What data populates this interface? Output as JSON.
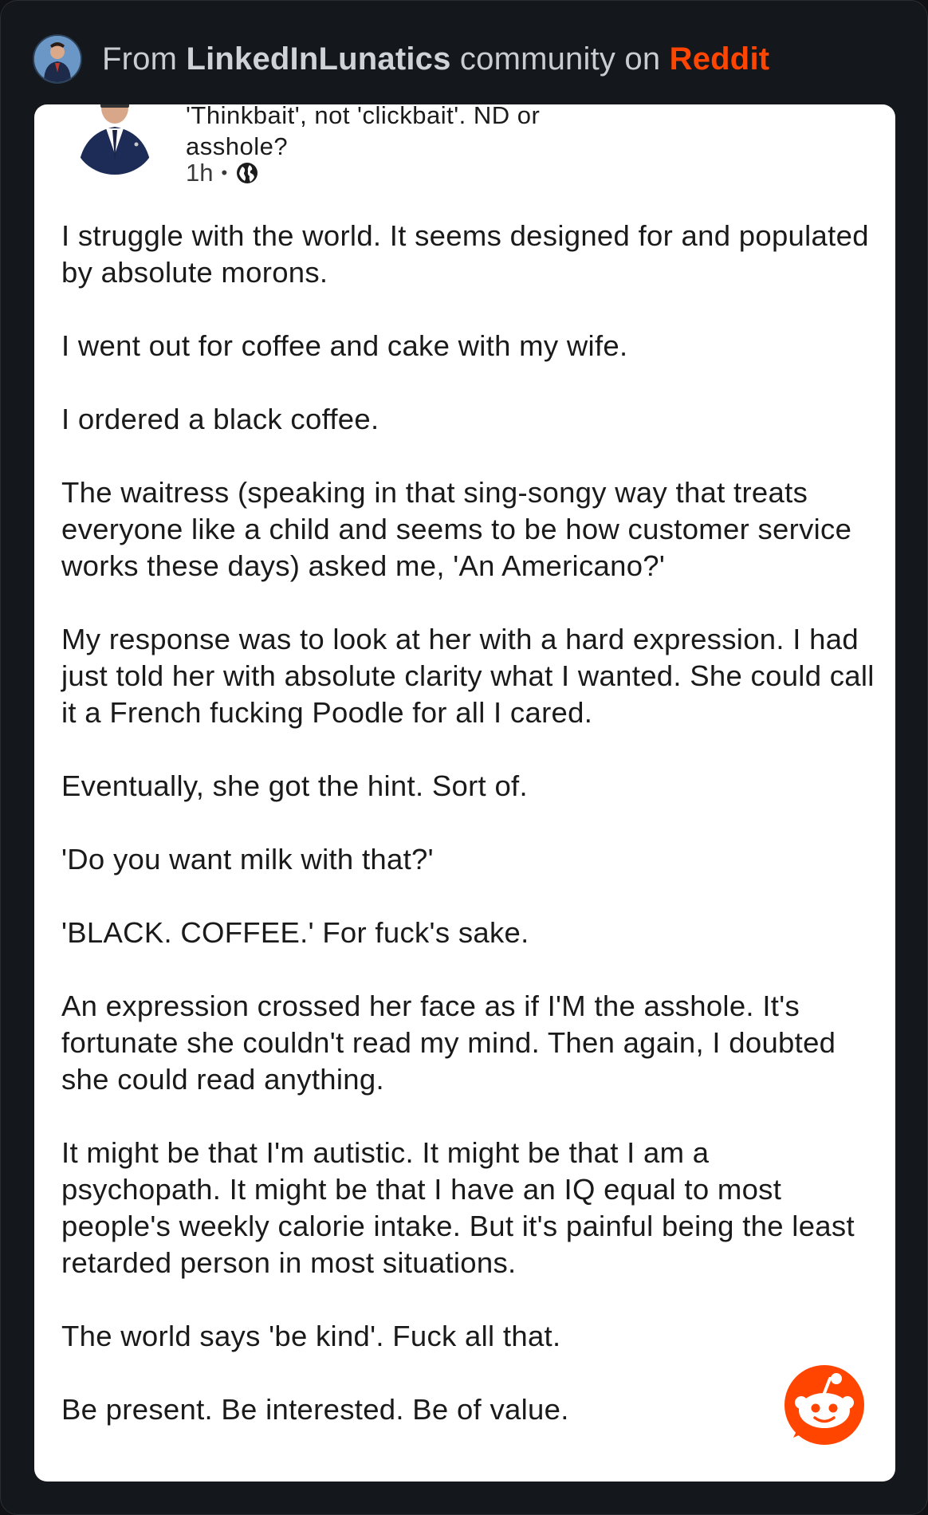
{
  "header": {
    "prefix": "From",
    "community": "LinkedInLunatics",
    "middle": "community on",
    "platform": "Reddit"
  },
  "post": {
    "title": "'Thinkbait', not 'clickbait'. ND or asshole?",
    "time": "1h",
    "visibility_icon": "globe-icon",
    "paragraphs": [
      "I struggle with the world. It seems designed for and populated by absolute morons.",
      "I went out for coffee and cake with my wife.",
      "I ordered a black coffee.",
      "The waitress (speaking in that sing-songy way that treats everyone like a child and seems to be how customer service works these days) asked me, 'An Americano?'",
      "My response was to look at her with a hard expression. I had just told her with absolute clarity what I wanted. She could call it a French fucking Poodle for all I cared.",
      "Eventually, she got the hint. Sort of.",
      "'Do you want milk with that?'",
      "'BLACK. COFFEE.' For fuck's sake.",
      "An expression crossed her face as if I'M the asshole. It's fortunate she couldn't read my mind. Then again, I doubted she could read anything.",
      "It might be that I'm autistic. It might be that I am a psychopath. It might be that I have an IQ equal to most people's weekly calorie intake. But it's painful being the least retarded person in most situations.",
      "The world says 'be kind'. Fuck all that.",
      "Be present. Be interested. Be of value."
    ]
  },
  "colors": {
    "background": "#0f1114",
    "card": "#ffffff",
    "reddit_orange": "#ff4500",
    "header_text": "#c9ccd1"
  }
}
